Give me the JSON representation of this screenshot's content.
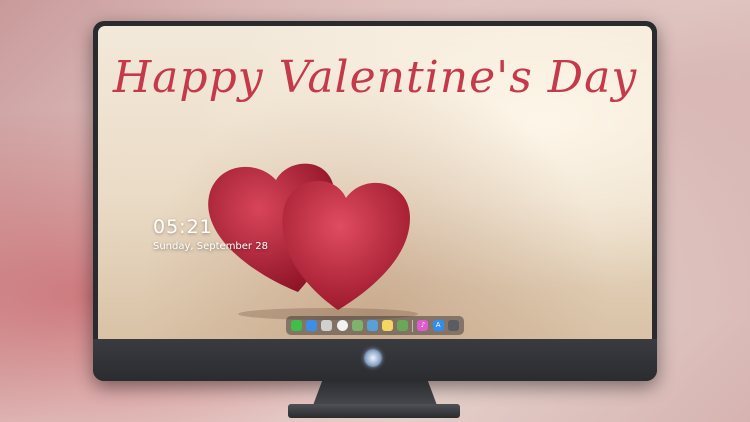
{
  "wallpaper": {
    "title": "Happy Valentine's Day"
  },
  "lock_screen": {
    "time": "05:21",
    "date": "Sunday, September 28"
  },
  "dock": {
    "icons": [
      {
        "name": "messages-icon",
        "color": "#3fbf4a"
      },
      {
        "name": "finder-icon",
        "color": "#3d8ee6"
      },
      {
        "name": "contacts-icon",
        "color": "#d0d0d0"
      },
      {
        "name": "clock-icon",
        "color": "#f2f2f2"
      },
      {
        "name": "preview-icon",
        "color": "#7fb36b"
      },
      {
        "name": "clapper-icon",
        "color": "#5aa0d8"
      },
      {
        "name": "notes-icon",
        "color": "#f4d660"
      },
      {
        "name": "photos-icon",
        "color": "#6aa857"
      },
      {
        "name": "music-icon",
        "color": "#e05ad0"
      },
      {
        "name": "app-store-icon",
        "color": "#2f8ff0"
      },
      {
        "name": "camera-icon",
        "color": "#5a5c62"
      }
    ]
  },
  "colors": {
    "title": "#c53a4b",
    "heart": "#b51f35",
    "bezel": "#2a2b2f"
  }
}
